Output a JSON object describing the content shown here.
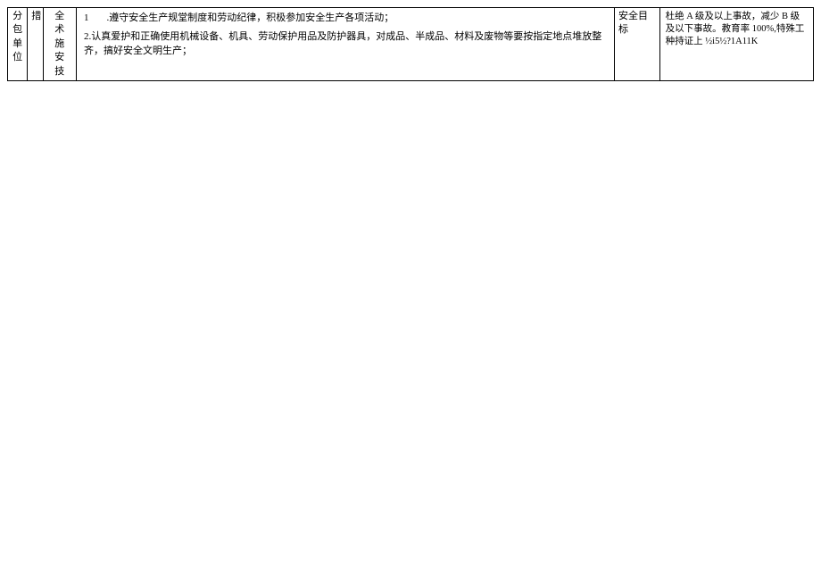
{
  "table": {
    "col1": "分\n包\n单\n位",
    "col2": "措",
    "col3": "全\n术\n施\n安\n技",
    "measures": {
      "item1_num": "1",
      "item1_text": ".遵守安全生产规堂制度和劳动纪律，积极参加安全生产各项活动；",
      "item2": "2.认真爱护和正确使用机械设备、机具、劳动保护用品及防护器具，对成品、半成品、材料及废物等要按指定地点堆放整齐，搞好安全文明生产；"
    },
    "col5": "安全目标",
    "targets": "杜绝 A 级及以上事故，减少 B 级及以下事故。教育率 100%,特殊工种持证上 ½i5½?1A11K"
  }
}
